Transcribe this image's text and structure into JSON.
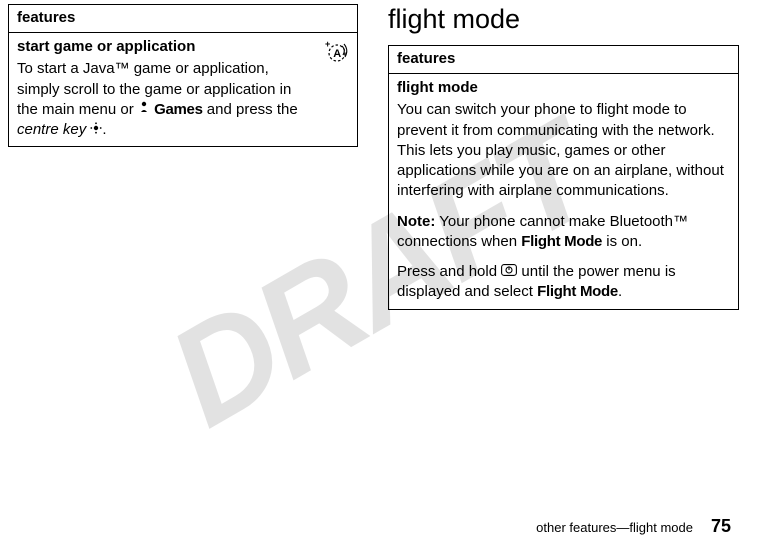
{
  "watermark": "DRAFT",
  "leftTable": {
    "header": "features",
    "subhead": "start game or application",
    "body_pre": "To start a Java",
    "tm1": "™",
    "body_mid": " game or application, simply scroll to the game or application in the main menu or ",
    "games_label": "Games",
    "body_post1": " and press the ",
    "centre_key": "centre key",
    "body_end": ".",
    "icon_name": "antenna-plus-icon"
  },
  "rightSection": {
    "title": "flight mode",
    "table": {
      "header": "features",
      "subhead": "flight mode",
      "p1_a": "You can switch your phone to flight mode to prevent it from communicating with the network. This lets you play music, games or other applications while you are on an airplane, without interfering with airplane communications.",
      "note_label": "Note:",
      "p2_a": " Your phone cannot make Bluetooth",
      "tm2": "™",
      "p2_b": " connections when ",
      "flight_mode_label": "Flight Mode",
      "p2_c": " is on.",
      "p3_a": "Press and hold ",
      "p3_b": " until the power menu is displayed and select ",
      "flight_mode_label2": "Flight Mode",
      "p3_c": "."
    }
  },
  "footer": {
    "text": "other features—flight mode",
    "page": "75"
  }
}
